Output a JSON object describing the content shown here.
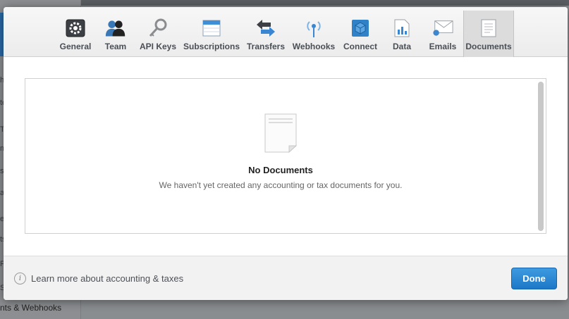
{
  "background": {
    "sidebar_fragments": [
      "h",
      "te",
      "T",
      "m",
      "s",
      "a",
      "e",
      "ts",
      "P",
      "S"
    ],
    "bottom_text": "nts & Webhooks"
  },
  "tabs": [
    {
      "label": "General",
      "icon": "gear-icon",
      "active": false
    },
    {
      "label": "Team",
      "icon": "team-icon",
      "active": false
    },
    {
      "label": "API Keys",
      "icon": "key-icon",
      "active": false
    },
    {
      "label": "Subscriptions",
      "icon": "calendar-icon",
      "active": false
    },
    {
      "label": "Transfers",
      "icon": "transfer-arrows-icon",
      "active": false
    },
    {
      "label": "Webhooks",
      "icon": "broadcast-icon",
      "active": false
    },
    {
      "label": "Connect",
      "icon": "cube-icon",
      "active": false
    },
    {
      "label": "Data",
      "icon": "chart-document-icon",
      "active": false
    },
    {
      "label": "Emails",
      "icon": "envelope-icon",
      "active": false
    },
    {
      "label": "Documents",
      "icon": "document-icon",
      "active": true
    }
  ],
  "empty_state": {
    "icon": "document-icon",
    "title": "No Documents",
    "message": "We haven't yet created any accounting or tax documents for you."
  },
  "footer": {
    "info_icon": "info-icon",
    "learn_more": "Learn more about accounting & taxes",
    "done_label": "Done"
  },
  "colors": {
    "primary_button": "#2a88d6",
    "overlay": "#8a8d90"
  }
}
